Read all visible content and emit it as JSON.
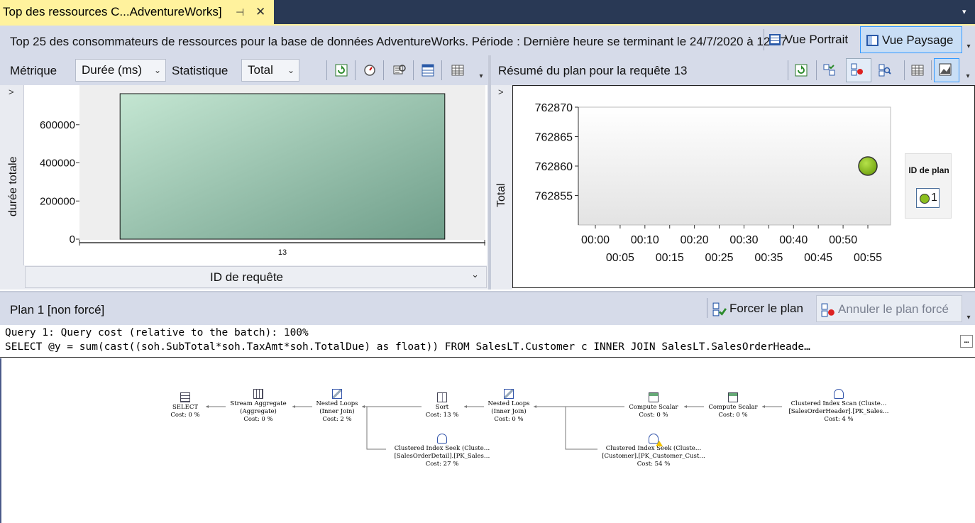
{
  "window": {
    "tab_title": "Top des ressources C...AdventureWorks]",
    "pin_glyph": "⊣",
    "close_glyph": "✕",
    "overflow_glyph": "▾"
  },
  "header": {
    "text": "Top 25 des consommateurs de ressources pour la base de données AdventureWorks. Période : Dernière heure se terminant le 24/7/2020 à 12:57",
    "portrait_label": "Vue Portrait",
    "landscape_label": "Vue Paysage"
  },
  "left_toolbar": {
    "metric_label": "Métrique",
    "metric_value": "Durée (ms)",
    "statistic_label": "Statistique",
    "statistic_value": "Total"
  },
  "left_chart": {
    "collapse_glyph": ">",
    "x_selector": "ID de requête"
  },
  "right_toolbar": {
    "title": "Résumé du plan pour la requête 13",
    "collapse_glyph": ">"
  },
  "legend": {
    "title": "ID de plan",
    "entry": "1"
  },
  "plan_bar": {
    "title": "Plan 1 [non forcé]",
    "force_label": "Forcer le plan",
    "unforce_label": "Annuler le plan forcé"
  },
  "query": {
    "line1": "Query 1: Query cost (relative to the batch): 100%",
    "line2": "SELECT @y = sum(cast((soh.SubTotal*soh.TaxAmt*soh.TotalDue) as float)) FROM SalesLT.Customer c INNER JOIN SalesLT.SalesOrderHeade…",
    "more_glyph": "…"
  },
  "plan_nodes": [
    {
      "name": "SELECT",
      "sub": "",
      "cost": "Cost: 0 %"
    },
    {
      "name": "Stream Aggregate",
      "sub": "(Aggregate)",
      "cost": "Cost: 0 %"
    },
    {
      "name": "Nested Loops",
      "sub": "(Inner Join)",
      "cost": "Cost: 2 %"
    },
    {
      "name": "Sort",
      "sub": "",
      "cost": "Cost: 13 %"
    },
    {
      "name": "Nested Loops",
      "sub": "(Inner Join)",
      "cost": "Cost: 0 %"
    },
    {
      "name": "Compute Scalar",
      "sub": "",
      "cost": "Cost: 0 %"
    },
    {
      "name": "Compute Scalar",
      "sub": "",
      "cost": "Cost: 0 %"
    },
    {
      "name": "Clustered Index Scan (Cluste…",
      "sub": "[SalesOrderHeader].[PK_Sales…",
      "cost": "Cost: 4 %"
    },
    {
      "name": "Clustered Index Seek (Cluste…",
      "sub": "[SalesOrderDetail].[PK_Sales…",
      "cost": "Cost: 27 %"
    },
    {
      "name": "Clustered Index Seek (Cluste…",
      "sub": "[Customer].[PK_Customer_Cust…",
      "cost": "Cost: 54 %"
    }
  ],
  "chart_data": [
    {
      "type": "bar",
      "title": "",
      "xlabel": "ID de requête",
      "ylabel": "durée totale",
      "categories": [
        "13"
      ],
      "values": [
        762860
      ],
      "ylim": [
        0,
        762860
      ],
      "yticks": [
        "0",
        "200000",
        "400000",
        "600000"
      ],
      "bar_color": "#7fae95"
    },
    {
      "type": "scatter",
      "title": "",
      "xlabel": "",
      "ylabel": "Total",
      "series": [
        {
          "name": "1",
          "x": [
            "00:55"
          ],
          "y": [
            762860
          ],
          "color": "#8bbf1f"
        }
      ],
      "ylim": [
        762850,
        762870
      ],
      "yticks": [
        "762855",
        "762860",
        "762865",
        "762870"
      ],
      "xticks_top": [
        "00:00",
        "00:10",
        "00:20",
        "00:30",
        "00:40",
        "00:50"
      ],
      "xticks_bottom": [
        "00:05",
        "00:15",
        "00:25",
        "00:35",
        "00:45",
        "00:55"
      ],
      "legend_position": "right"
    }
  ]
}
